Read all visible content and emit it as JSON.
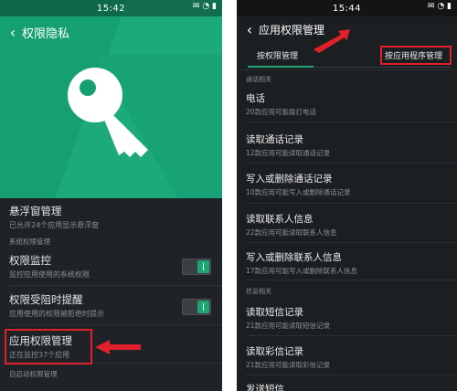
{
  "left": {
    "status_time": "15:42",
    "title": "权限隐私",
    "items": {
      "floating_window": {
        "title": "悬浮窗管理",
        "sub": "已允许24个应用显示悬浮窗"
      },
      "section_system": "系统权限管理",
      "perm_monitor": {
        "title": "权限监控",
        "sub": "监控应用使用的系统权限"
      },
      "perm_blocked": {
        "title": "权限受阻时提醒",
        "sub": "应用使用的权限被拒绝时提示"
      },
      "app_perm_manage": {
        "title": "应用权限管理",
        "sub": "正在监控37个应用"
      },
      "section_autostart": "自启动权限管理"
    }
  },
  "right": {
    "status_time": "15:44",
    "title": "应用权限管理",
    "tabs": [
      "按权限管理",
      "按应用程序管理"
    ],
    "section_call": "通话相关",
    "rows": [
      {
        "title": "电话",
        "sub": "20款应用可能拨打电话"
      },
      {
        "title": "读取通话记录",
        "sub": "12款应用可能读取通话记录"
      },
      {
        "title": "写入或删除通话记录",
        "sub": "10款应用可能写入或删除通话记录"
      },
      {
        "title": "读取联系人信息",
        "sub": "22款应用可能读取联系人信息"
      },
      {
        "title": "写入或删除联系人信息",
        "sub": "17款应用可能写入或删除联系人信息"
      }
    ],
    "section_sms": "信息相关",
    "rows2": [
      {
        "title": "读取短信记录",
        "sub": "21款应用可能读取短信记录"
      },
      {
        "title": "读取彩信记录",
        "sub": "21款应用可能读取彩信记录"
      },
      {
        "title": "发送短信"
      }
    ]
  },
  "colors": {
    "accent": "#1fa56f",
    "highlight": "#e0202a",
    "hero": "#16a072"
  }
}
